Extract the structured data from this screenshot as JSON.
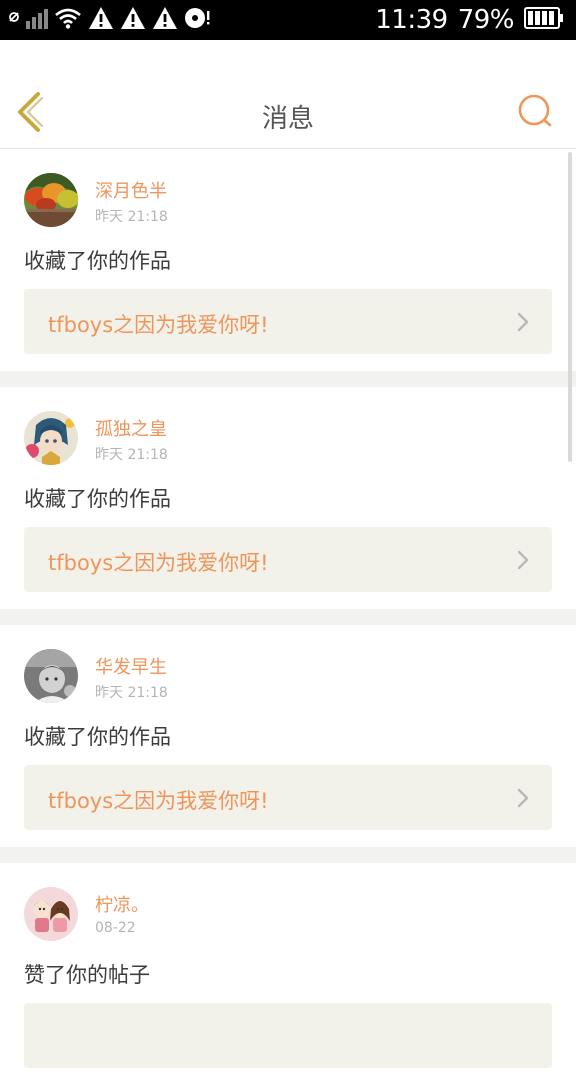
{
  "status_bar": {
    "time": "11:39",
    "battery": "79%",
    "icons": [
      "sync-icon",
      "signal-icon",
      "wifi-icon",
      "warning-icon",
      "warning-icon",
      "warning-icon",
      "disc-icon",
      "battery-icon"
    ]
  },
  "header": {
    "title": "消息"
  },
  "colors": {
    "accent": "#f0955a",
    "back_icon": "#c9a83a",
    "card_box": "#f2f2ea",
    "separator": "#f2f2f0"
  },
  "messages": [
    {
      "user": "深月色半",
      "time": "昨天 21:18",
      "action": "收藏了你的作品",
      "work": "tfboys之因为我爱你呀!",
      "avatar": "autumn-leaves-avatar"
    },
    {
      "user": "孤独之皇",
      "time": "昨天 21:18",
      "action": "收藏了你的作品",
      "work": "tfboys之因为我爱你呀!",
      "avatar": "anime-girl-avatar"
    },
    {
      "user": "华发早生",
      "time": "昨天 21:18",
      "action": "收藏了你的作品",
      "work": "tfboys之因为我爱你呀!",
      "avatar": "baby-photo-avatar"
    },
    {
      "user": "柠凉。",
      "time": "08-22",
      "action": "赞了你的帖子",
      "work": "",
      "avatar": "cartoon-couple-avatar"
    }
  ]
}
